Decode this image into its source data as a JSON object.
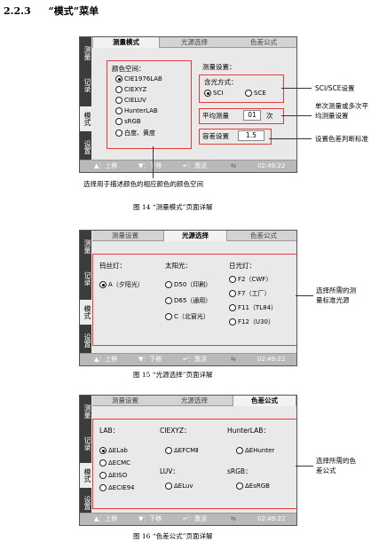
{
  "section": {
    "number": "2.2.3",
    "title": "“模式”菜单"
  },
  "side_menu": [
    "测量",
    "记录",
    "模式",
    "设置"
  ],
  "bottom_bar": {
    "up": "▲：上移",
    "down": "▼：下移",
    "activate": "↵：激活",
    "pc_icon": "⇆",
    "time": "02:49:22"
  },
  "fig14": {
    "tabs": [
      "测量模式",
      "光源选择",
      "色差公式"
    ],
    "color_space_title": "颜色空间：",
    "color_spaces": [
      "CIE1976LAB",
      "CIEXYZ",
      "CIELUV",
      "HunterLAB",
      "sRGB",
      "白度、黄度"
    ],
    "measure_settings_title": "测量设置：",
    "specular_label": "含光方式：",
    "sci": "SCI",
    "sce": "SCE",
    "avg_label": "平均测量",
    "avg_value": "01",
    "avg_unit": "次",
    "tol_label": "容差设置",
    "tol_value": "1.5",
    "annot_sci": "SCI/SCE设置",
    "annot_avg_1": "单次测量或多次平",
    "annot_avg_2": "均测量设置",
    "annot_tol": "设置色差判断标准",
    "annot_bottom": "选择用于描述颜色的相应颜色的颜色空间",
    "caption": "图 14 “测量模式”页面详解"
  },
  "fig15": {
    "tabs": [
      "测量设置",
      "光源选择",
      "色差公式"
    ],
    "tungsten_title": "钨丝灯：",
    "tungsten": [
      "A（夕阳光）"
    ],
    "sun_title": "太阳光：",
    "sun": [
      "D50（印刷）",
      "D65（通用）",
      "C（北窗光）"
    ],
    "fluor_title": "日光灯：",
    "fluor": [
      "F2（CWF）",
      "F7（工厂）",
      "F11（TL84）",
      "F12（U30）"
    ],
    "annot_1": "选择所需的测",
    "annot_2": "量标准光源",
    "caption": "图 15 “光源选择”页面详解"
  },
  "fig16": {
    "tabs": [
      "测量设置",
      "光源选择",
      "色差公式"
    ],
    "lab_title": "LAB：",
    "lab": [
      "ΔELab",
      "ΔECMC",
      "ΔEISO",
      "ΔECIE94"
    ],
    "xyz_title": "CIEXYZ：",
    "xyz": [
      "ΔEFCMⅡ"
    ],
    "luv_title": "LUV：",
    "luv": [
      "ΔELuv"
    ],
    "hunter_title": "HunterLAB：",
    "hunter": [
      "ΔEHunter"
    ],
    "srgb_title": "sRGB：",
    "srgb": [
      "ΔEsRGB"
    ],
    "annot_1": "选择所需的色",
    "annot_2": "差公式",
    "caption": "图 16 “色差公式”页面详解"
  }
}
